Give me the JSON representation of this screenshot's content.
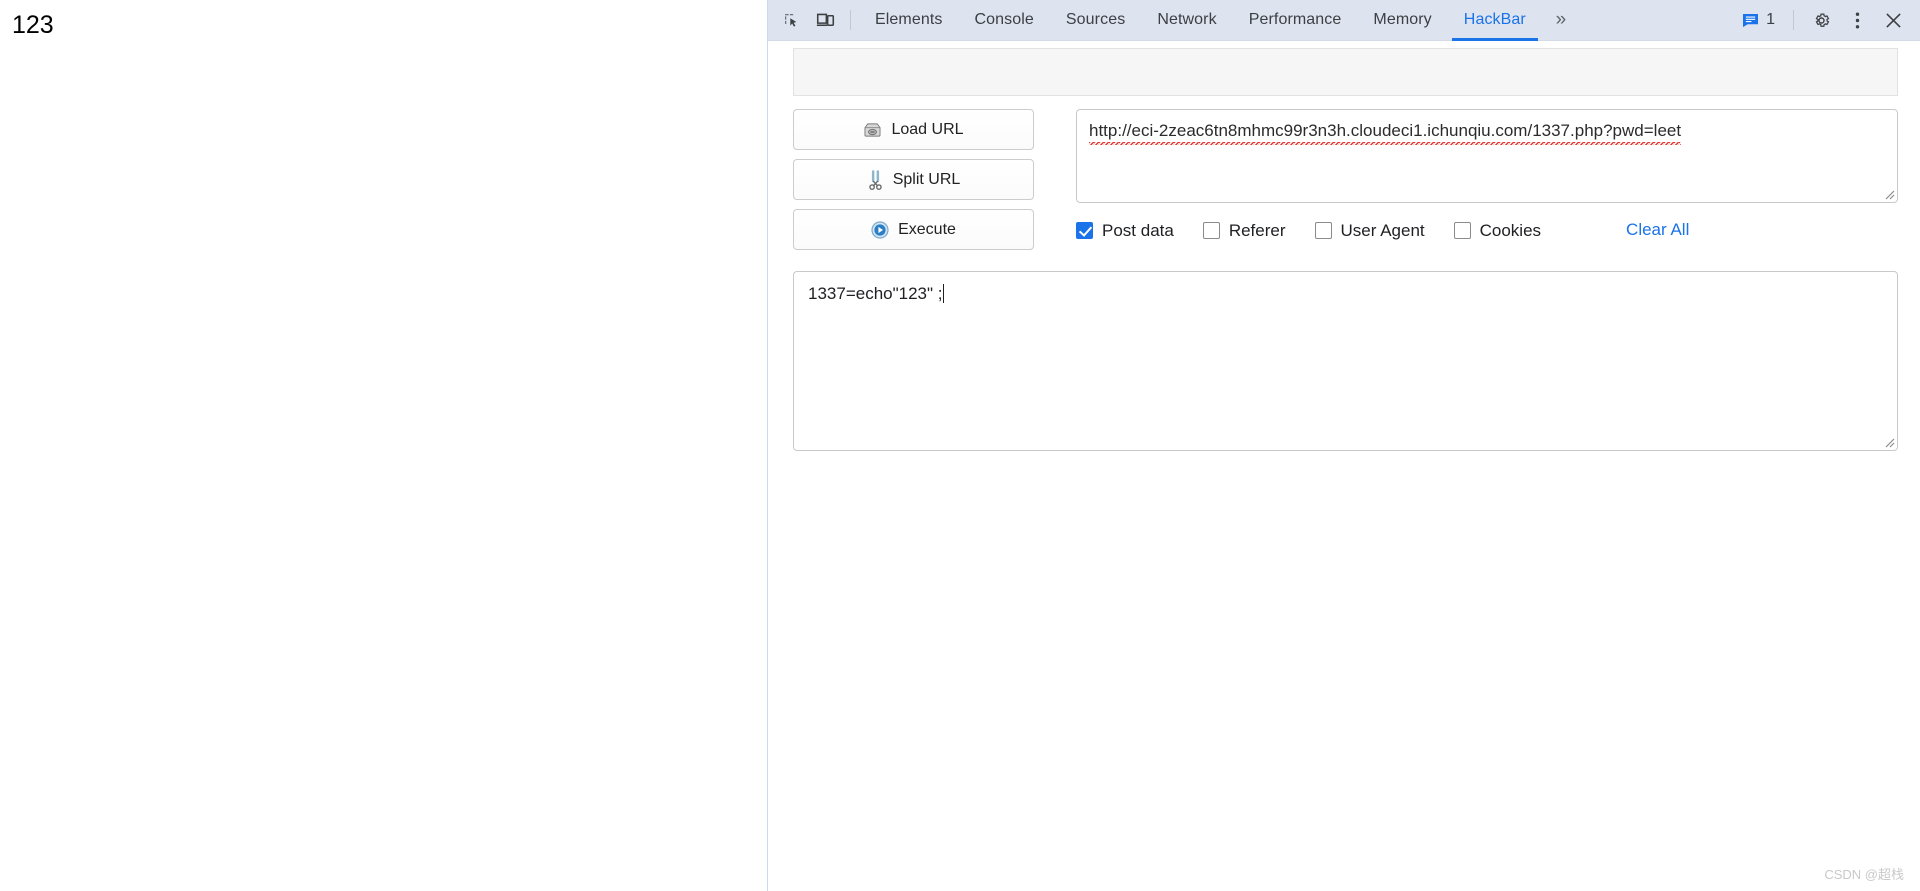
{
  "page": {
    "body_text": "123"
  },
  "devtools": {
    "inspect_icon": "inspect-element-icon",
    "device_icon": "device-toolbar-icon",
    "tabs": [
      {
        "label": "Elements",
        "active": false
      },
      {
        "label": "Console",
        "active": false
      },
      {
        "label": "Sources",
        "active": false
      },
      {
        "label": "Network",
        "active": false
      },
      {
        "label": "Performance",
        "active": false
      },
      {
        "label": "Memory",
        "active": false
      },
      {
        "label": "HackBar",
        "active": true
      }
    ],
    "overflow_label": "»",
    "messages": {
      "icon": "message-drawer-icon",
      "count": "1"
    },
    "settings_icon": "gear-icon",
    "more_icon": "kebab-menu-icon",
    "close_icon": "close-icon",
    "accent_color": "#1a73e8",
    "toolbar_bg": "#dee3f0"
  },
  "hackbar": {
    "buttons": [
      {
        "label": "Load URL",
        "icon": "load-url-icon"
      },
      {
        "label": "Split URL",
        "icon": "split-url-scissors-icon"
      },
      {
        "label": "Execute",
        "icon": "execute-play-icon"
      }
    ],
    "url_field": {
      "value": "http://eci-2zeac6tn8mhmc99r3n3h.cloudeci1.ichunqiu.com/1337.php?pwd=leet",
      "placeholder": "URL"
    },
    "options": [
      {
        "label": "Post data",
        "checked": true
      },
      {
        "label": "Referer",
        "checked": false
      },
      {
        "label": "User Agent",
        "checked": false
      },
      {
        "label": "Cookies",
        "checked": false
      }
    ],
    "clear_all_label": "Clear All",
    "post_data_field": {
      "value": "1337=echo\"123\" ;",
      "placeholder": "Post data"
    }
  },
  "watermark": {
    "text": "CSDN @超栈"
  }
}
